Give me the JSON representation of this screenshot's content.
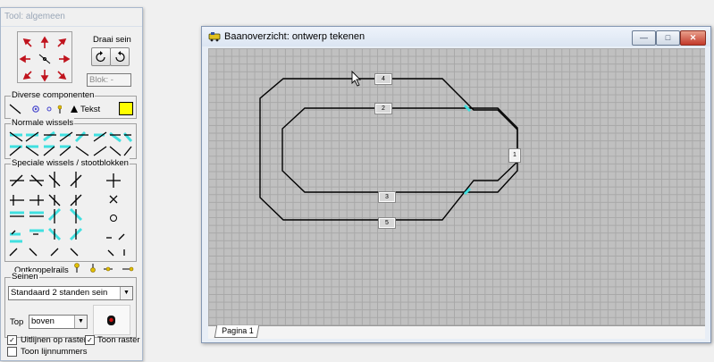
{
  "tool_window": {
    "title": "Tool: algemeen",
    "rotate_label": "Draai sein",
    "block_label": "Blok: -",
    "misc_components_label": "Diverse componenten",
    "text_label": "Tekst",
    "normal_switches_label": "Normale wissels",
    "special_switches_label": "Speciale wissels / stootblokken",
    "uncoupling_label": "Ontkoppelrails",
    "signals_label": "Seinen",
    "signal_type": "Standaard 2 standen sein",
    "top_label": "Top",
    "top_value": "boven",
    "align_grid_label": "Uitlijnen op raster",
    "show_grid_label": "Toon raster",
    "show_line_numbers_label": "Toon lijnnummers",
    "align_grid_checked": "✓",
    "show_grid_checked": "✓",
    "show_line_numbers_checked": ""
  },
  "main_window": {
    "title": "Baanoverzicht: ontwerp tekenen",
    "minimize": "—",
    "maximize": "□",
    "close": "✕",
    "tab_label": "Pagina 1",
    "blocks": [
      "4",
      "2",
      "1",
      "3",
      "5"
    ]
  },
  "colors": {
    "accent_cyan": "#40e0e0",
    "text_swatch": "#ffff00",
    "grid_bg": "#c0c0c0"
  }
}
